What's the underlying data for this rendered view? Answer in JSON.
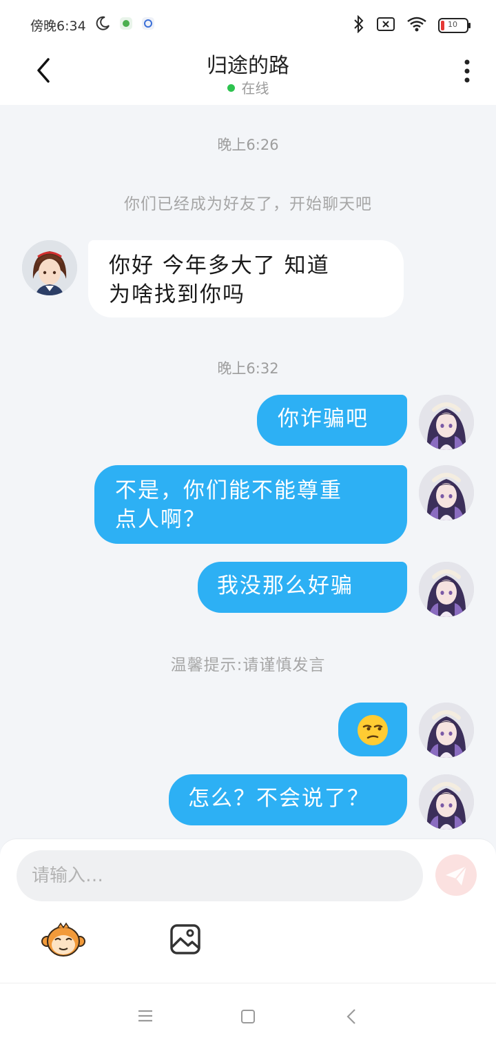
{
  "status_bar": {
    "time": "傍晚6:34",
    "battery": "10",
    "icons": [
      "moon-icon",
      "app-icon",
      "app-icon",
      "bluetooth-icon",
      "sim-off-icon",
      "wifi-icon",
      "battery-icon"
    ]
  },
  "header": {
    "title": "归途的路",
    "status": "在线"
  },
  "chat": {
    "timestamp_1": "晚上6:26",
    "system_notice": "你们已经成为好友了，开始聊天吧",
    "messages": [
      {
        "from": "other",
        "text_line1": "你好 今年多大了 知道",
        "text_line2": "为啥找到你吗"
      },
      {
        "from": "me",
        "text": "你诈骗吧"
      },
      {
        "from": "me",
        "text_line1": "不是，你们能不能尊重",
        "text_line2": "点人啊？"
      },
      {
        "from": "me",
        "text": "我没那么好骗"
      },
      {
        "from": "me",
        "text": "😒"
      },
      {
        "from": "me",
        "text": "怎么？不会说了？"
      }
    ],
    "timestamp_2": "晚上6:32",
    "tip": "温馨提示:请谨慎发言"
  },
  "composer": {
    "placeholder": "请输入…"
  },
  "colors": {
    "outgoing_bubble": "#2db0f4",
    "incoming_bubble": "#ffffff",
    "background": "#f3f5f8",
    "online_dot": "#2ec34f"
  }
}
